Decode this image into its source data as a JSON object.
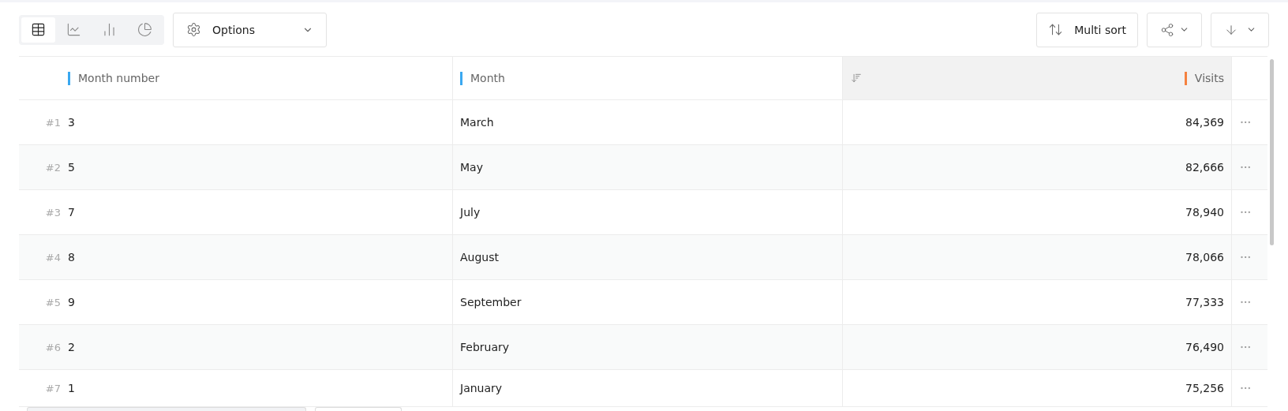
{
  "toolbar": {
    "views": [
      {
        "kind": "table",
        "selected": true
      },
      {
        "kind": "line",
        "selected": false
      },
      {
        "kind": "bar",
        "selected": false
      },
      {
        "kind": "pie",
        "selected": false
      }
    ],
    "options_label": "Options",
    "multi_sort_label": "Multi sort"
  },
  "table": {
    "columns": [
      {
        "label": "Month number",
        "color": "#3aa8f0",
        "sorted": false
      },
      {
        "label": "Month",
        "color": "#3aa8f0",
        "sorted": false
      },
      {
        "label": "Visits",
        "color": "#f5813f",
        "sorted": true
      }
    ],
    "rows": [
      {
        "rank": "#1",
        "cells": [
          "3",
          "March",
          "84,369"
        ]
      },
      {
        "rank": "#2",
        "cells": [
          "5",
          "May",
          "82,666"
        ]
      },
      {
        "rank": "#3",
        "cells": [
          "7",
          "July",
          "78,940"
        ]
      },
      {
        "rank": "#4",
        "cells": [
          "8",
          "August",
          "78,066"
        ]
      },
      {
        "rank": "#5",
        "cells": [
          "9",
          "September",
          "77,333"
        ]
      },
      {
        "rank": "#6",
        "cells": [
          "2",
          "February",
          "76,490"
        ]
      },
      {
        "rank": "#7",
        "cells": [
          "1",
          "January",
          "75,256"
        ]
      }
    ]
  }
}
